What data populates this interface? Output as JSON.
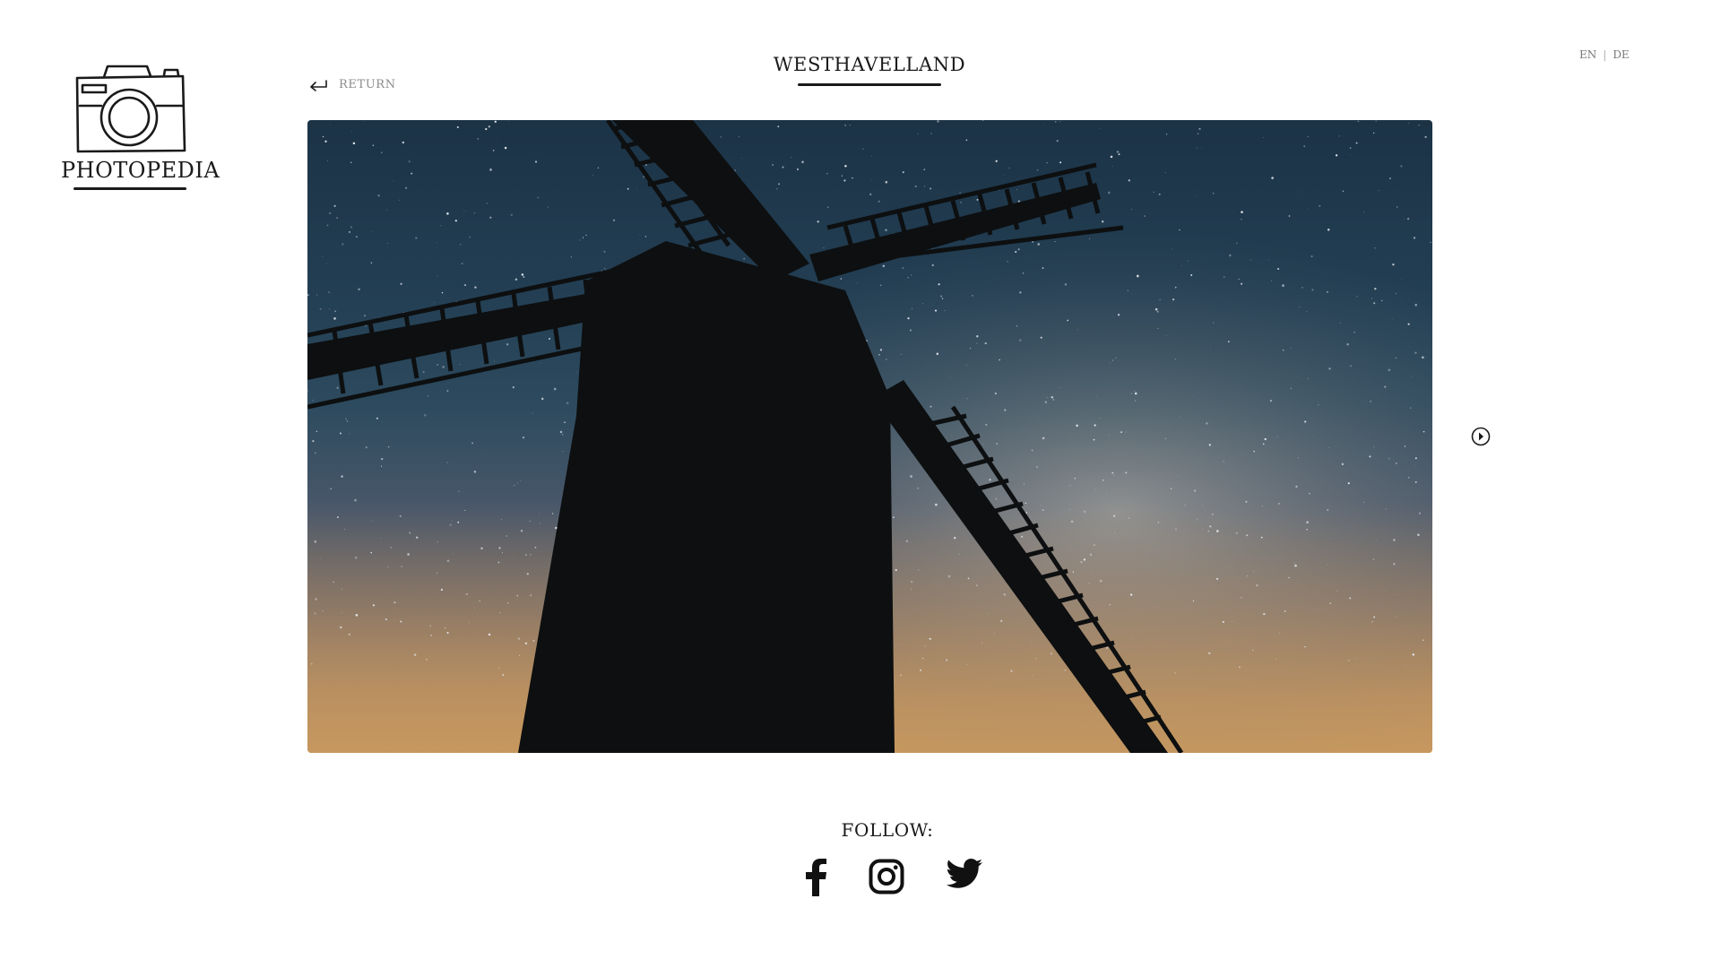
{
  "logo": {
    "text": "PHOTOPEDIA",
    "icon": "camera-icon"
  },
  "nav": {
    "return_label": "RETURN",
    "return_icon": "return-arrow-icon"
  },
  "page": {
    "title": "WESTHAVELLAND"
  },
  "languages": {
    "en": "EN",
    "separator": "|",
    "de": "DE"
  },
  "photo": {
    "subject": "windmill-night-sky-photo",
    "colors": {
      "sky_top": "#1c3346",
      "sky_horizon": "#c2935e",
      "silhouette": "#0d0f10"
    }
  },
  "gallery": {
    "next_icon": "next-circle-arrow-icon"
  },
  "footer": {
    "follow_label": "FOLLOW:",
    "social": [
      {
        "name": "facebook",
        "icon": "facebook-icon"
      },
      {
        "name": "instagram",
        "icon": "instagram-icon"
      },
      {
        "name": "twitter",
        "icon": "twitter-icon"
      }
    ]
  }
}
